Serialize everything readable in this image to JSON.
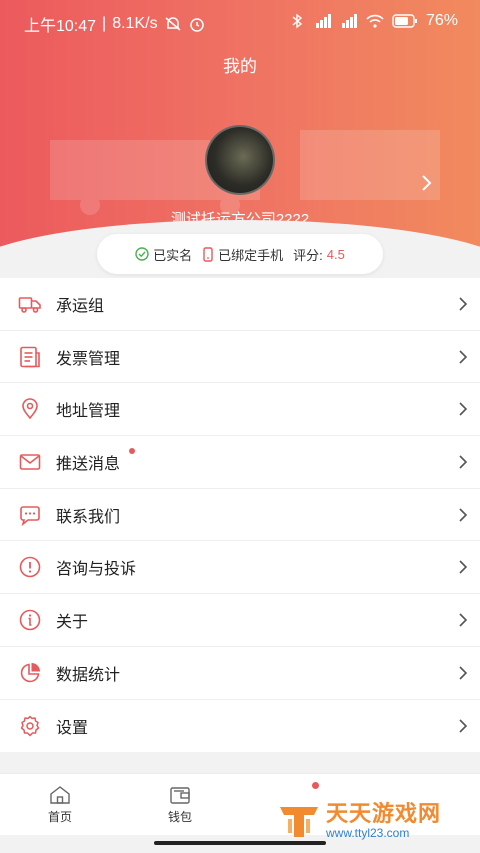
{
  "statusbar": {
    "time": "上午10:47",
    "speed": "8.1K/s",
    "battery": "76%"
  },
  "header": {
    "title": "我的",
    "company": "测试托运方公司2222"
  },
  "badges": {
    "verified": "已实名",
    "phone": "已绑定手机",
    "score_label": "评分:",
    "score_value": "4.5"
  },
  "menu": [
    {
      "label": "承运组",
      "icon": "truck-icon"
    },
    {
      "label": "发票管理",
      "icon": "invoice-icon"
    },
    {
      "label": "地址管理",
      "icon": "location-pin-icon"
    },
    {
      "label": "推送消息",
      "icon": "mail-icon",
      "has_dot": true
    },
    {
      "label": "联系我们",
      "icon": "chat-bubble-icon"
    },
    {
      "label": "咨询与投诉",
      "icon": "exclamation-icon"
    },
    {
      "label": "关于",
      "icon": "info-icon"
    },
    {
      "label": "数据统计",
      "icon": "pie-chart-icon"
    },
    {
      "label": "设置",
      "icon": "gear-icon"
    }
  ],
  "tabbar": {
    "home": "首页",
    "wallet": "钱包"
  },
  "watermark": {
    "title": "天天游戏网",
    "url": "www.ttyl23.com"
  },
  "colors": {
    "accent": "#e65a5c",
    "header_left": "#ec5a5d",
    "header_right": "#f18a5e"
  }
}
